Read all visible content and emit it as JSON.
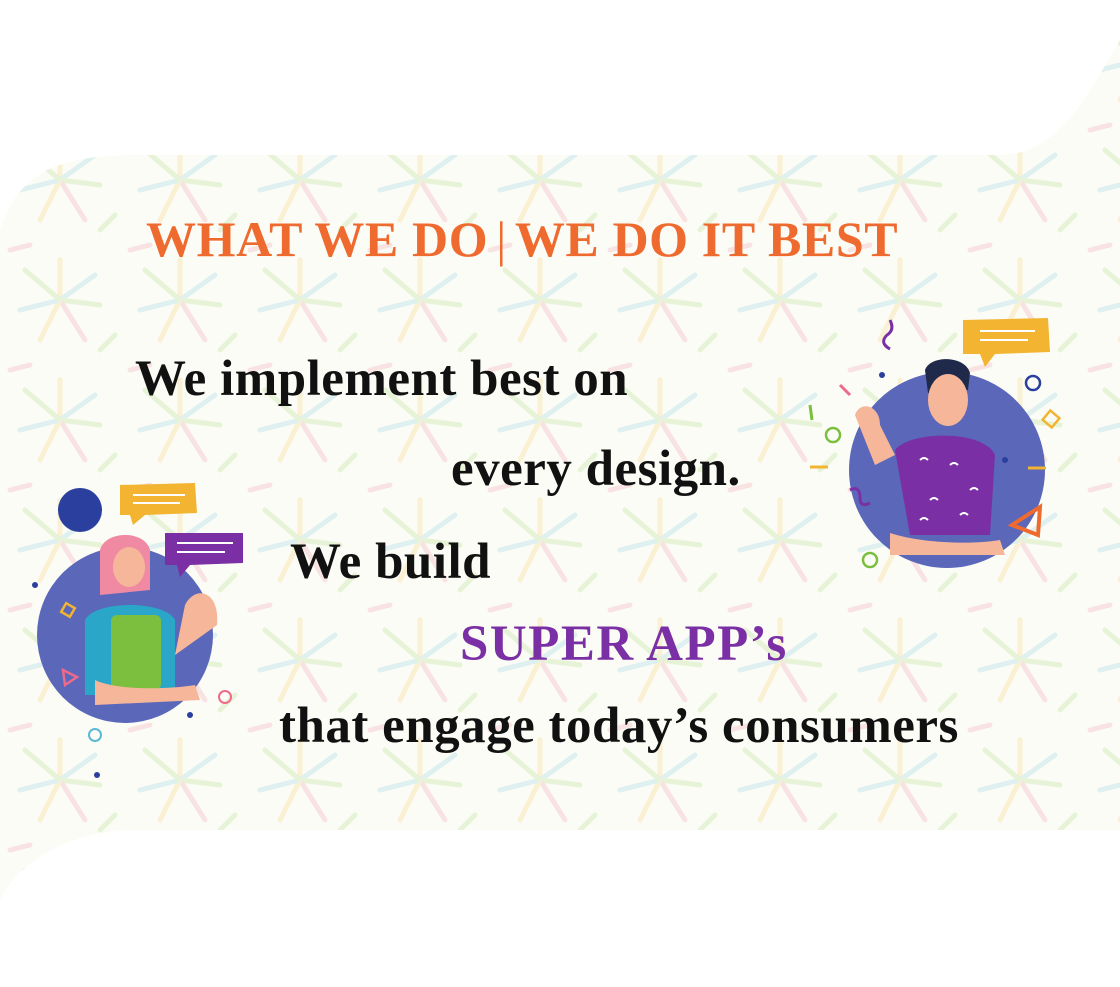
{
  "heading": {
    "left": "WHAT WE DO",
    "separator": "|",
    "right": "WE DO IT BEST",
    "color": "#ef6a2f"
  },
  "lines": [
    "We implement best on",
    "every design.",
    "We build",
    "SUPER APP’s",
    "that engage today’s consumers"
  ],
  "accent_color": "#7b2fa5",
  "illustrations": [
    "woman-chatting-illustration",
    "man-waving-illustration"
  ]
}
